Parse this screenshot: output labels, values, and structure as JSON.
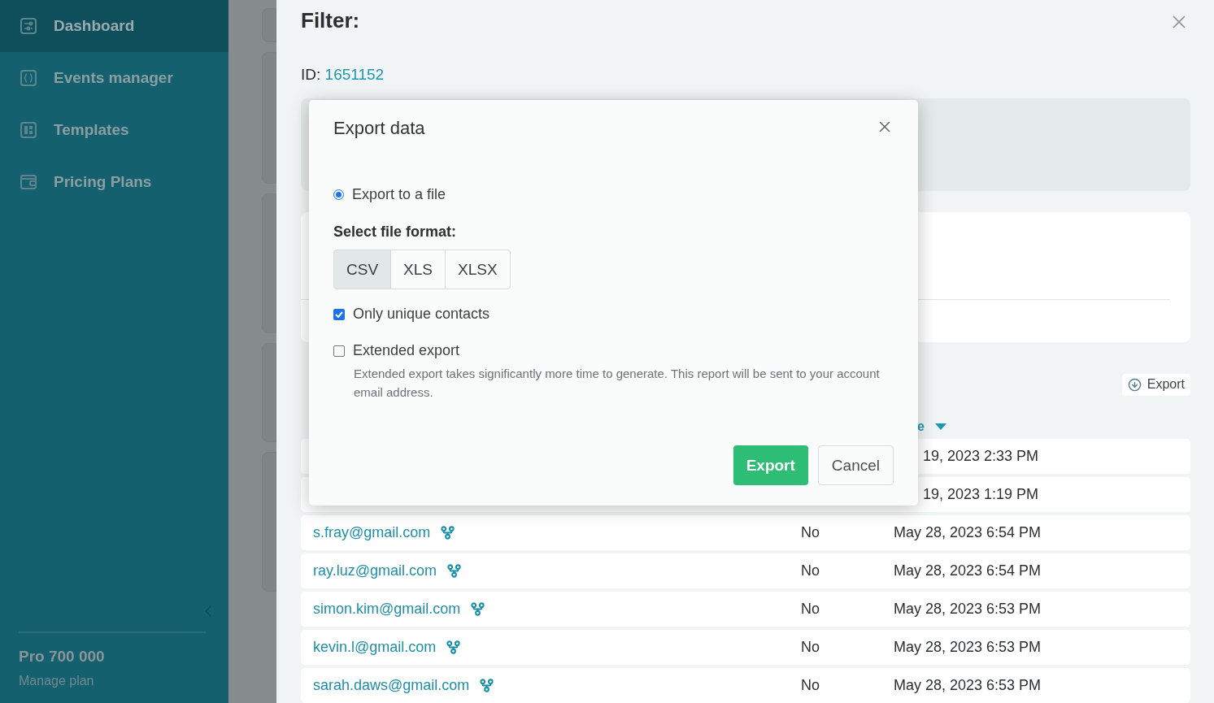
{
  "sidebar": {
    "items": [
      {
        "label": "Dashboard",
        "selected": true
      },
      {
        "label": "Events manager",
        "selected": false
      },
      {
        "label": "Templates",
        "selected": false
      },
      {
        "label": "Pricing Plans",
        "selected": false
      }
    ],
    "plan": {
      "name": "Pro 700 000",
      "link": "Manage plan"
    }
  },
  "drawer": {
    "title": "Filter:",
    "id_label": "ID:",
    "id_value": "1651152",
    "export_button": "Export",
    "table": {
      "header_fragment": "e",
      "rows": [
        {
          "date": "19, 2023 2:33 PM"
        },
        {
          "date": "19, 2023 1:19 PM"
        },
        {
          "email": "s.fray@gmail.com",
          "unique": "No",
          "date": "May 28, 2023 6:54 PM"
        },
        {
          "email": "ray.luz@gmail.com",
          "unique": "No",
          "date": "May 28, 2023 6:54 PM"
        },
        {
          "email": "simon.kim@gmail.com",
          "unique": "No",
          "date": "May 28, 2023 6:53 PM"
        },
        {
          "email": "kevin.l@gmail.com",
          "unique": "No",
          "date": "May 28, 2023 6:53 PM"
        },
        {
          "email": "sarah.daws@gmail.com",
          "unique": "No",
          "date": "May 28, 2023 6:53 PM"
        }
      ]
    }
  },
  "modal": {
    "title": "Export data",
    "options": [
      {
        "label": "Export to a file",
        "selected": true
      }
    ],
    "format_label": "Select file format:",
    "formats": [
      {
        "label": "CSV",
        "selected": true
      },
      {
        "label": "XLS",
        "selected": false
      },
      {
        "label": "XLSX",
        "selected": false
      }
    ],
    "checkboxes": [
      {
        "label": "Only unique contacts",
        "checked": true
      },
      {
        "label": "Extended export",
        "checked": false,
        "note": "Extended export takes significantly more time to generate. This report will be sent to your account email address."
      }
    ],
    "buttons": [
      {
        "label": "Export",
        "kind": "primary"
      },
      {
        "label": "Cancel",
        "kind": "secondary"
      }
    ]
  }
}
